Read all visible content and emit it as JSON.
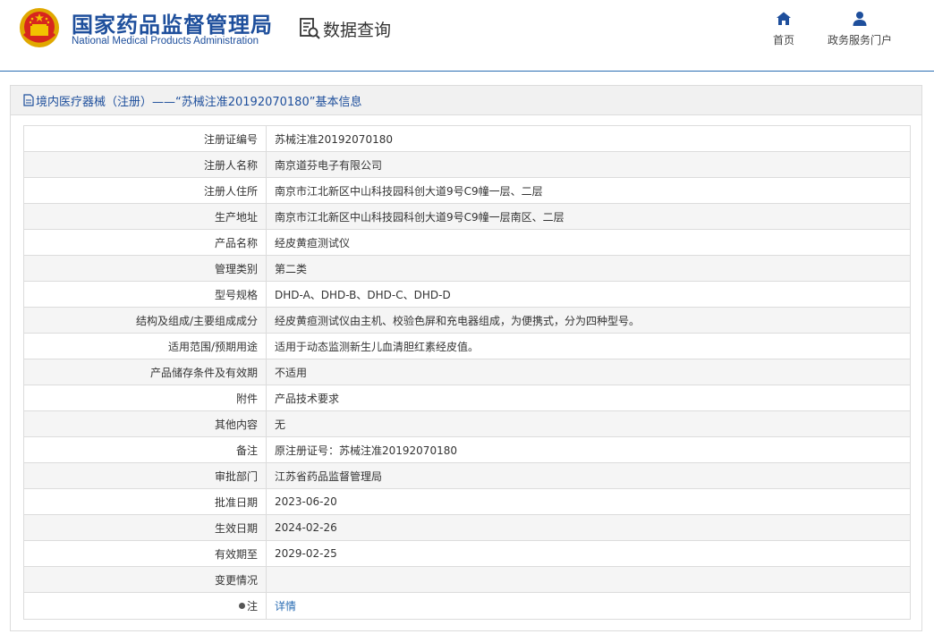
{
  "header": {
    "brand_cn": "国家药品监督管理局",
    "brand_en": "National Medical Products Administration",
    "query_label": "数据查询",
    "nav": [
      {
        "label": "首页",
        "icon": "home-icon"
      },
      {
        "label": "政务服务门户",
        "icon": "user-icon"
      }
    ]
  },
  "panel": {
    "title": "境内医疗器械（注册）——“苏械注准20192070180”基本信息",
    "rows": [
      {
        "label": "注册证编号",
        "value": "苏械注准20192070180"
      },
      {
        "label": "注册人名称",
        "value": "南京道芬电子有限公司"
      },
      {
        "label": "注册人住所",
        "value": "南京市江北新区中山科技园科创大道9号C9幢一层、二层"
      },
      {
        "label": "生产地址",
        "value": "南京市江北新区中山科技园科创大道9号C9幢一层南区、二层"
      },
      {
        "label": "产品名称",
        "value": "经皮黄疸测试仪"
      },
      {
        "label": "管理类别",
        "value": "第二类"
      },
      {
        "label": "型号规格",
        "value": "DHD-A、DHD-B、DHD-C、DHD-D"
      },
      {
        "label": "结构及组成/主要组成成分",
        "value": "经皮黄疸测试仪由主机、校验色屏和充电器组成，为便携式，分为四种型号。"
      },
      {
        "label": "适用范围/预期用途",
        "value": "适用于动态监测新生儿血清胆红素经皮值。"
      },
      {
        "label": "产品储存条件及有效期",
        "value": "不适用"
      },
      {
        "label": "附件",
        "value": "产品技术要求"
      },
      {
        "label": "其他内容",
        "value": "无"
      },
      {
        "label": "备注",
        "value": "原注册证号：苏械注准20192070180"
      },
      {
        "label": "审批部门",
        "value": "江苏省药品监督管理局"
      },
      {
        "label": "批准日期",
        "value": "2023-06-20"
      },
      {
        "label": "生效日期",
        "value": "2024-02-26"
      },
      {
        "label": "有效期至",
        "value": "2029-02-25"
      },
      {
        "label": "变更情况",
        "value": ""
      }
    ],
    "note_label": "注",
    "note_link": "详情"
  },
  "colors": {
    "brand_blue": "#1e4f9c",
    "link_blue": "#2a6db3",
    "emblem_red": "#d7261e",
    "emblem_gold": "#f2c200"
  }
}
